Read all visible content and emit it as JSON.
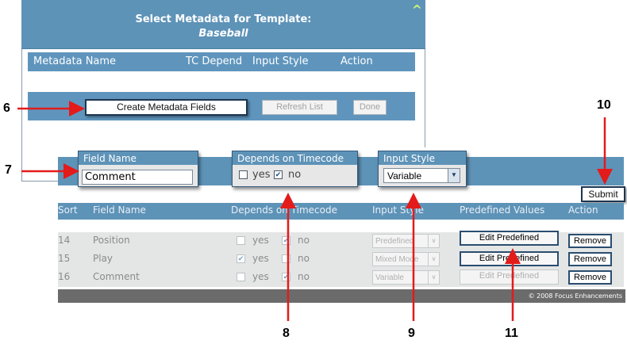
{
  "top_panel": {
    "title": "Select Metadata for Template:",
    "subtitle": "Baseball",
    "columns": [
      "Metadata Name",
      "TC Depend",
      "Input Style",
      "Action"
    ],
    "create_button": "Create Metadata Fields",
    "refresh_button": "Refresh List",
    "done_button": "Done"
  },
  "form": {
    "field_name_label": "Field Name",
    "field_name_value": "Comment",
    "depends_label": "Depends on Timecode",
    "yes_label": "yes",
    "no_label": "no",
    "depends_yes_checked": false,
    "depends_no_checked": true,
    "input_style_label": "Input Style",
    "input_style_value": "Variable",
    "submit_button": "Submit"
  },
  "table": {
    "headers": [
      "Sort",
      "Field Name",
      "Depends on Timecode",
      "Input Style",
      "Predefined Values",
      "Action"
    ],
    "rows": [
      {
        "sort": "14",
        "name": "Position",
        "yes": "yes",
        "no": "no",
        "yes_checked": false,
        "no_checked": true,
        "style": "Predefined",
        "edit": "Edit Predefined",
        "edit_enabled": true,
        "action": "Remove"
      },
      {
        "sort": "15",
        "name": "Play",
        "yes": "yes",
        "no": "no",
        "yes_checked": true,
        "no_checked": false,
        "style": "Mixed Mode",
        "edit": "Edit Predefined",
        "edit_enabled": true,
        "action": "Remove"
      },
      {
        "sort": "16",
        "name": "Comment",
        "yes": "yes",
        "no": "no",
        "yes_checked": false,
        "no_checked": true,
        "style": "Variable",
        "edit": "Edit Predefined",
        "edit_enabled": false,
        "action": "Remove"
      }
    ],
    "footer": "© 2008 Focus Enhancements"
  },
  "callouts": [
    "6",
    "7",
    "8",
    "9",
    "10",
    "11"
  ],
  "colors": {
    "header_blue": "#5e93b8",
    "arrow_red": "#e31b1b"
  }
}
